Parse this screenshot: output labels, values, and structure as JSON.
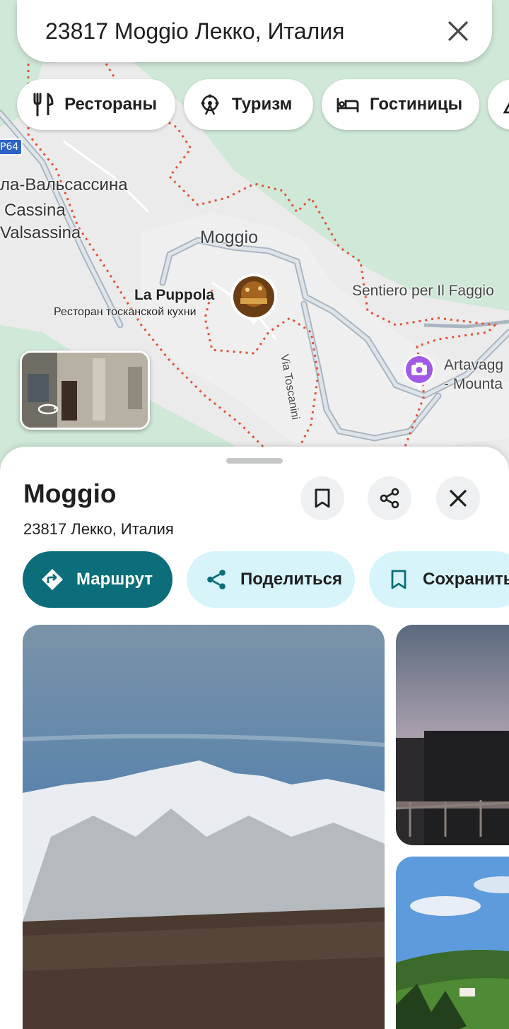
{
  "search": {
    "query": "23817 Moggio Лекко, Италия",
    "close_icon": "close-icon"
  },
  "chips": [
    {
      "label": "Рестораны",
      "icon": "fork-knife-icon"
    },
    {
      "label": "Туризм",
      "icon": "ferris-wheel-icon"
    },
    {
      "label": "Гостиницы",
      "icon": "bed-icon"
    }
  ],
  "map": {
    "road_shield": "P64",
    "labels": {
      "moggio": "Moggio",
      "valsassina_1": "ла-Вальсассина",
      "valsassina_2": "Cassina",
      "valsassina_3": "Valsassina",
      "sentiero": "Sentiero per Il Faggio",
      "artavaggio_1": "Artavagg",
      "artavaggio_2": "- Mounta",
      "restaurant_name": "La Puppola",
      "restaurant_desc": "Ресторан тосканской кухни",
      "street": "Via Toscanini"
    },
    "colors": {
      "park": "#cfe8d7",
      "area": "#ebebeb",
      "boundary": "#e0533a",
      "road": "#a9b6c2"
    }
  },
  "place": {
    "title": "Moggio",
    "address": "23817 Лекко, Италия"
  },
  "actions": {
    "route": "Маршрут",
    "share": "Поделиться",
    "save": "Сохранить"
  },
  "accent_color": "#0b6e7a"
}
